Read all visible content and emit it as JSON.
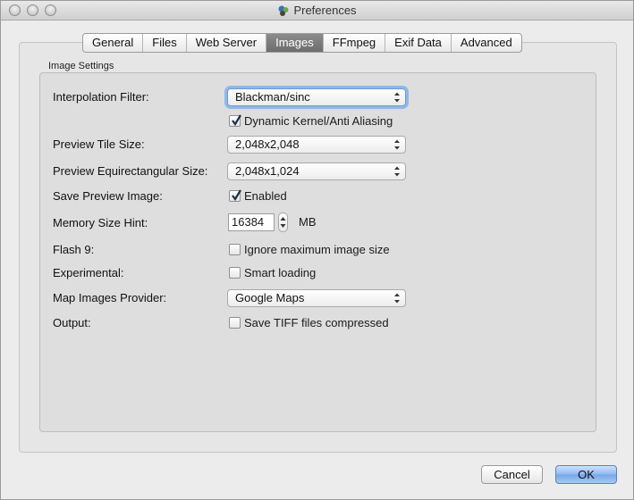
{
  "window": {
    "title": "Preferences"
  },
  "tabs": [
    {
      "label": "General",
      "active": false
    },
    {
      "label": "Files",
      "active": false
    },
    {
      "label": "Web Server",
      "active": false
    },
    {
      "label": "Images",
      "active": true
    },
    {
      "label": "FFmpeg",
      "active": false
    },
    {
      "label": "Exif Data",
      "active": false
    },
    {
      "label": "Advanced",
      "active": false
    }
  ],
  "group": {
    "label": "Image Settings"
  },
  "settings": {
    "interpolation_filter": {
      "label": "Interpolation Filter:",
      "value": "Blackman/sinc"
    },
    "dynamic_kernel": {
      "label": "Dynamic Kernel/Anti Aliasing",
      "checked": true
    },
    "preview_tile_size": {
      "label": "Preview Tile Size:",
      "value": "2,048x2,048"
    },
    "preview_equirect_size": {
      "label": "Preview Equirectangular Size:",
      "value": "2,048x1,024"
    },
    "save_preview_image": {
      "label": "Save Preview Image:",
      "option": "Enabled",
      "checked": true
    },
    "memory_size_hint": {
      "label": "Memory Size Hint:",
      "value": "16384",
      "unit": "MB"
    },
    "flash9": {
      "label": "Flash 9:",
      "option": "Ignore maximum image size",
      "checked": false
    },
    "experimental": {
      "label": "Experimental:",
      "option": "Smart loading",
      "checked": false
    },
    "map_images_provider": {
      "label": "Map Images Provider:",
      "value": "Google Maps"
    },
    "output": {
      "label": "Output:",
      "option": "Save TIFF files compressed",
      "checked": false
    }
  },
  "buttons": {
    "cancel": "Cancel",
    "ok": "OK"
  },
  "icons": {
    "window": "app-icon",
    "checkmark": "checkmark-icon",
    "popup": "updown-arrows-icon"
  },
  "colors": {
    "active_tab": "#7b7b7b",
    "focus_ring": "#8fb8e8",
    "default_button": "#8fb8ef"
  }
}
